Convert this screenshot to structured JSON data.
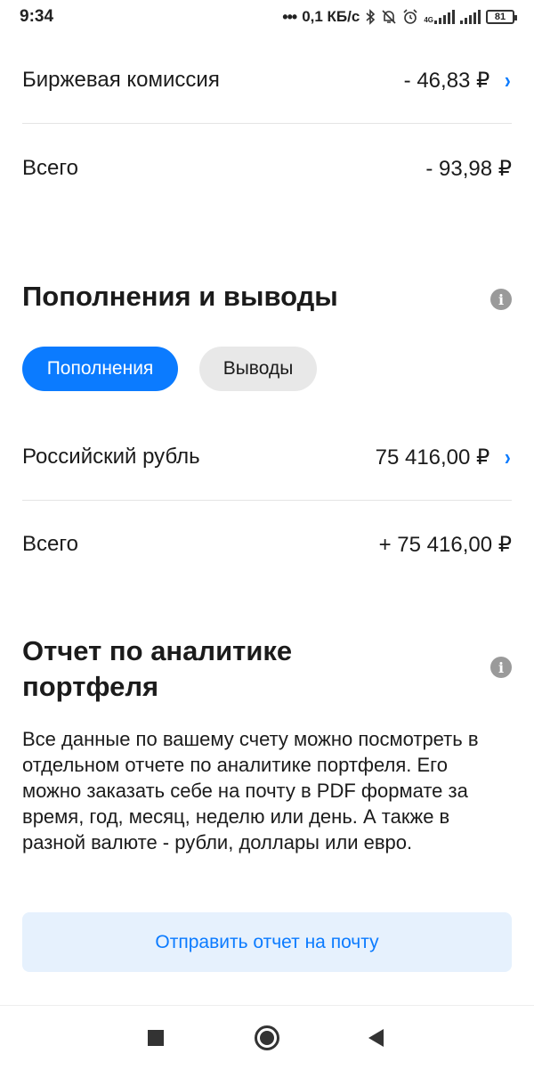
{
  "status_bar": {
    "time": "9:34",
    "dots": "•••",
    "network_speed": "0,1 КБ/с",
    "network_type": "4G",
    "battery_level": "81"
  },
  "commission": {
    "label": "Биржевая комиссия",
    "value": "- 46,83 ₽"
  },
  "commission_total": {
    "label": "Всего",
    "value": "- 93,98 ₽"
  },
  "deposits_withdrawals": {
    "title": "Пополнения и выводы",
    "tabs": [
      {
        "label": "Пополнения",
        "selected": true
      },
      {
        "label": "Выводы",
        "selected": false
      }
    ],
    "rows": [
      {
        "label": "Российский рубль",
        "value": "75 416,00 ₽"
      }
    ],
    "total": {
      "label": "Всего",
      "value": "+ 75 416,00 ₽"
    }
  },
  "analytics_report": {
    "title_line1": "Отчет по аналитике",
    "title_line2": "портфеля",
    "description": "Все данные по вашему счету можно посмотреть в отдельном отчете по аналитике портфеля. Его можно заказать себе на почту в PDF формате за время, год, месяц, неделю или день. А также в разной валюте - рубли, доллары или евро.",
    "button_label": "Отправить отчет на почту"
  },
  "icons": {
    "info": "i",
    "chevron": "›"
  },
  "colors": {
    "accent": "#0b7bff",
    "button_bg": "#e6f1fd",
    "chip_inactive": "#e8e8e8",
    "info_icon": "#9a9a9a"
  }
}
